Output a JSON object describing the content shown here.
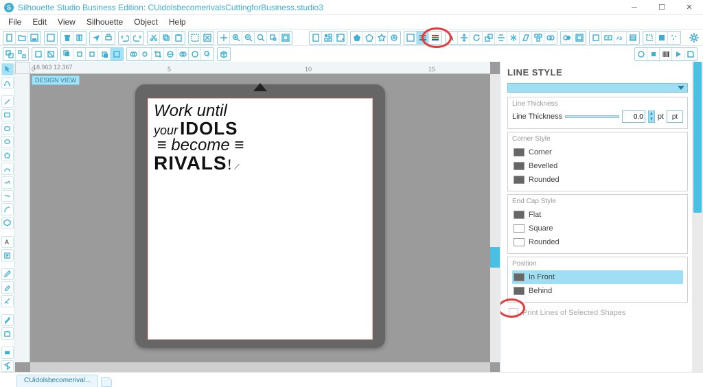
{
  "app": {
    "title": "Silhouette Studio Business Edition: CUidolsbecomerivalsCuttingforBusiness.studio3"
  },
  "menu": [
    "File",
    "Edit",
    "View",
    "Silhouette",
    "Object",
    "Help"
  ],
  "canvas": {
    "coords": "18.963   12.367",
    "badge": "DESIGN VIEW",
    "ruler_marks": {
      "0": "0",
      "5": "5",
      "10": "10",
      "15": "15"
    }
  },
  "artwork": {
    "l1": "Work until",
    "l2a": "your",
    "l2b": "IDOLS",
    "l3": "≡ become ≡",
    "l4": "RIVALS",
    "exc": "!"
  },
  "tab": "CUidolsbecomerival...",
  "panel": {
    "title": "LINE STYLE",
    "sections": {
      "thickness": {
        "label": "Line Thickness",
        "row_label": "Line Thickness",
        "value": "0.0",
        "unit1": "pt",
        "unit2": "pt"
      },
      "corner": {
        "label": "Corner Style",
        "options": [
          "Corner",
          "Bevelled",
          "Rounded"
        ]
      },
      "endcap": {
        "label": "End Cap Style",
        "options": [
          "Flat",
          "Square",
          "Rounded"
        ]
      },
      "position": {
        "label": "Position",
        "options": [
          "In Front",
          "Behind"
        ],
        "selected": 0
      },
      "print_lines": "Print Lines of Selected Shapes"
    }
  }
}
